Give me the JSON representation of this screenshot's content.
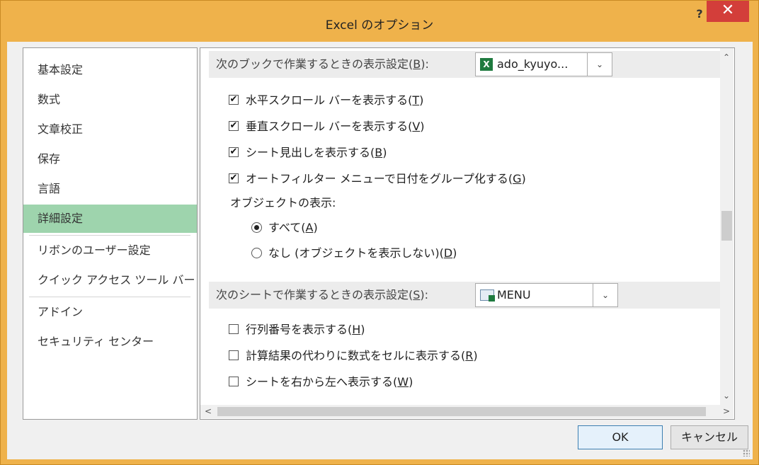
{
  "window": {
    "title": "Excel のオプション",
    "help_label": "?",
    "close_label": "✕"
  },
  "nav": {
    "items": [
      {
        "label": "基本設定"
      },
      {
        "label": "数式"
      },
      {
        "label": "文章校正"
      },
      {
        "label": "保存"
      },
      {
        "label": "言語"
      },
      {
        "label": "詳細設定"
      },
      {
        "label": "リボンのユーザー設定"
      },
      {
        "label": "クイック アクセス ツール バー"
      },
      {
        "label": "アドイン"
      },
      {
        "label": "セキュリティ センター"
      }
    ],
    "selected": "詳細設定"
  },
  "book_section": {
    "heading_prefix": "次のブックで作業するときの表示設定(",
    "heading_key": "B",
    "heading_suffix": "):",
    "combo_value": "ado_kyuyo...",
    "combo_icon": "excel-workbook-icon",
    "options": [
      {
        "prefix": "水平スクロール バーを表示する(",
        "key": "T",
        "suffix": ")",
        "checked": true
      },
      {
        "prefix": "垂直スクロール バーを表示する(",
        "key": "V",
        "suffix": ")",
        "checked": true
      },
      {
        "prefix": "シート見出しを表示する(",
        "key": "B",
        "suffix": ")",
        "checked": true
      },
      {
        "prefix": "オートフィルター メニューで日付をグループ化する(",
        "key": "G",
        "suffix": ")",
        "checked": true
      }
    ],
    "objects_label": "オブジェクトの表示:",
    "radios": [
      {
        "prefix": "すべて(",
        "key": "A",
        "suffix": ")",
        "selected": true
      },
      {
        "prefix": "なし (オブジェクトを表示しない)(",
        "key": "D",
        "suffix": ")",
        "selected": false
      }
    ]
  },
  "sheet_section": {
    "heading_prefix": "次のシートで作業するときの表示設定(",
    "heading_key": "S",
    "heading_suffix": "):",
    "combo_value": "MENU",
    "combo_icon": "excel-sheet-icon",
    "options": [
      {
        "prefix": "行列番号を表示する(",
        "key": "H",
        "suffix": ")",
        "checked": false
      },
      {
        "prefix": "計算結果の代わりに数式をセルに表示する(",
        "key": "R",
        "suffix": ")",
        "checked": false
      },
      {
        "prefix": "シートを右から左へ表示する(",
        "key": "W",
        "suffix": ")",
        "checked": false
      }
    ]
  },
  "scroll": {
    "up": "⌃",
    "down": "⌄",
    "left": "<",
    "right": ">"
  },
  "buttons": {
    "ok": "OK",
    "cancel": "キャンセル"
  },
  "colors": {
    "title_bar": "#efb24b",
    "close": "#d33e3a",
    "selected_nav": "#9ed4ad"
  }
}
